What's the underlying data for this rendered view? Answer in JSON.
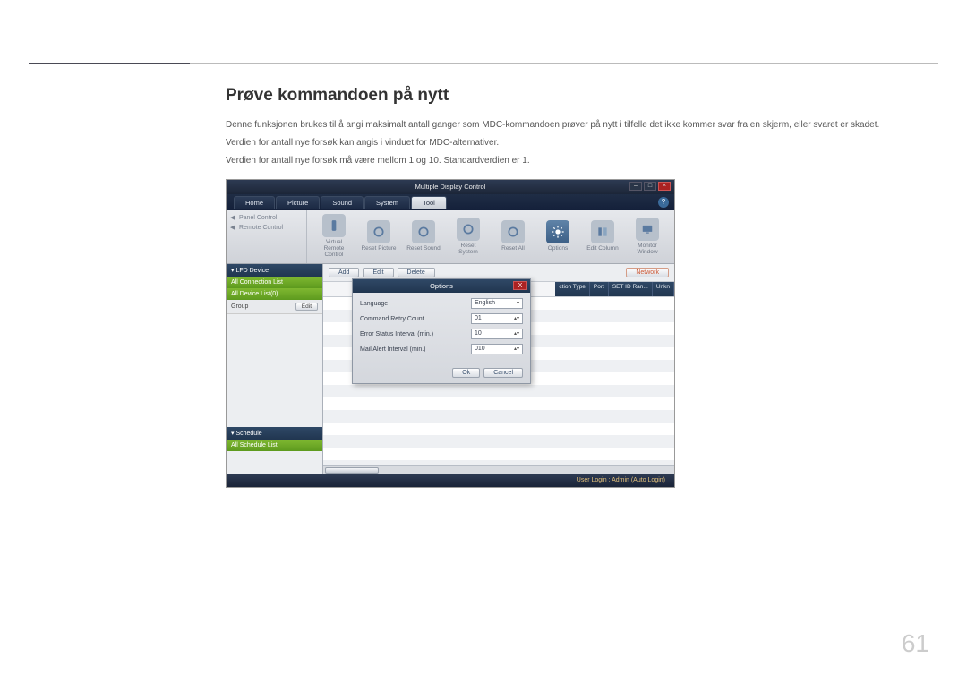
{
  "page": {
    "heading": "Prøve kommandoen på nytt",
    "paragraph1": "Denne funksjonen brukes til å angi maksimalt antall ganger som MDC-kommandoen prøver på nytt i tilfelle det ikke kommer svar fra en skjerm, eller svaret er skadet.",
    "paragraph2": "Verdien for antall nye forsøk kan angis i vinduet for MDC-alternativer.",
    "paragraph3": "Verdien for antall nye forsøk må være mellom 1 og 10. Standardverdien er 1.",
    "number": "61"
  },
  "app": {
    "title": "Multiple Display Control",
    "menu": [
      "Home",
      "Picture",
      "Sound",
      "System",
      "Tool"
    ],
    "active_menu_index": 4,
    "help": "?",
    "ribbon_left": {
      "row1": "Panel Control",
      "row2": "Remote Control"
    },
    "ribbon_tools": [
      {
        "label": "Virtual Remote Control"
      },
      {
        "label": "Reset Picture"
      },
      {
        "label": "Reset Sound"
      },
      {
        "label": "Reset System"
      },
      {
        "label": "Reset All"
      },
      {
        "label": "Options"
      },
      {
        "label": "Edit Column"
      },
      {
        "label": "Monitor Window"
      }
    ],
    "sidebar": {
      "lfd_header": "▾ LFD Device",
      "conn_list": "All Connection List",
      "dev_list": "All Device List(0)",
      "group_label": "Group",
      "group_edit": "Edit",
      "schedule_header": "▾ Schedule",
      "schedule_list": "All Schedule List"
    },
    "toolbar2": {
      "add": "Add",
      "edit": "Edit",
      "delete": "Delete",
      "network": "Network"
    },
    "table_headers": [
      "ction Type",
      "Port",
      "SET ID Ran...",
      "Unkn"
    ],
    "status": "User Login : Admin (Auto Login)"
  },
  "dialog": {
    "title": "Options",
    "rows": [
      {
        "label": "Language",
        "value": "English",
        "type": "dropdown"
      },
      {
        "label": "Command Retry Count",
        "value": "01",
        "type": "spinner"
      },
      {
        "label": "Error Status Interval (min.)",
        "value": "10",
        "type": "spinner"
      },
      {
        "label": "Mail Alert Interval (min.)",
        "value": "010",
        "type": "spinner"
      }
    ],
    "ok": "Ok",
    "cancel": "Cancel"
  }
}
